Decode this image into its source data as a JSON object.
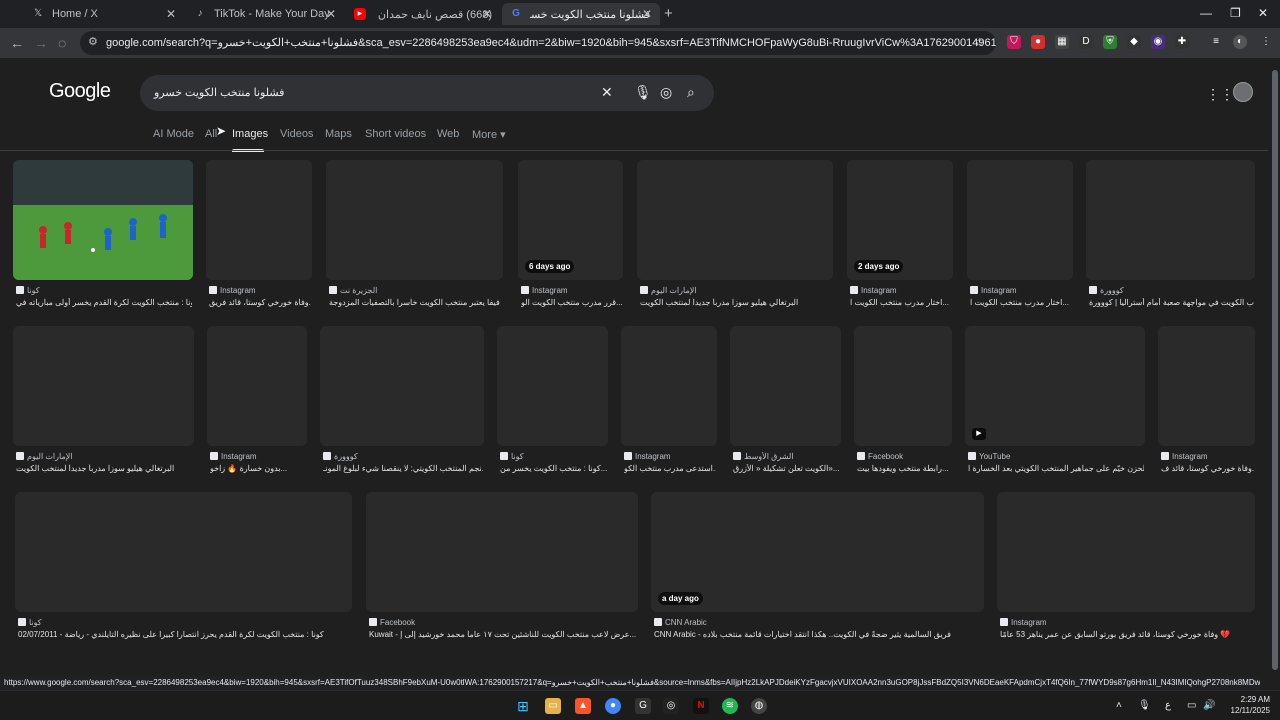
{
  "browser": {
    "tabs": [
      {
        "label": "Home / X",
        "icon": "x-logo-icon",
        "glyph": "𝕏"
      },
      {
        "label": "TikTok - Make Your Day",
        "icon": "tiktok-icon",
        "glyph": "♪"
      },
      {
        "label": "(668) قصص نايف حمدان للنوم ف",
        "icon": "youtube-icon",
        "glyph": "▶"
      },
      {
        "label": "فشلونا منتخب الكويت خسرو - ch",
        "icon": "google-icon",
        "glyph": "G"
      }
    ],
    "new_tab": "+",
    "url": "google.com/search?q=فشلونا+منتخب+الكويت+خسرو&sca_esv=2286498253ea9ec4&udm=2&biw=1920&bih=945&sxsrf=AE3TifNMCHOFpaWyG8uBi-RruugIvrViCw%3A1762900149617&ei=tbgTafS4Jauri-gP28..."
  },
  "google": {
    "logo": "Google",
    "query": "فشلونا منتخب الكويت خسرو",
    "nav": [
      {
        "label": "AI Mode"
      },
      {
        "label": "All"
      },
      {
        "label": "Images"
      },
      {
        "label": "Videos"
      },
      {
        "label": "Maps"
      },
      {
        "label": "Short videos"
      },
      {
        "label": "Web"
      },
      {
        "label": "More ▾"
      }
    ]
  },
  "results": [
    {
      "source": "كونا",
      "title": "كونا : منتخب الكويت لكرة القدم يخسر أولى مبارياته في...",
      "badge": "",
      "photo": true
    },
    {
      "source": "Instagram",
      "title": "وفاة خورخي كوستا، قائد فريق...",
      "badge": ""
    },
    {
      "source": "الجزيرة نت",
      "title": "فيفا يعتبر منتخب الكويت خاسرا بالتصفيات المزدوجة | ...",
      "badge": ""
    },
    {
      "source": "Instagram",
      "title": "قرر مدرب منتخب الكويت الو...",
      "badge": "6 days ago"
    },
    {
      "source": "الإمارات اليوم",
      "title": "البرتغالي هيليو سوزا مدرباً جديداً لمنتخب الكويت",
      "badge": ""
    },
    {
      "source": "Instagram",
      "title": "اختار مدرب منتخب الكويت ا...",
      "badge": "2 days ago"
    },
    {
      "source": "Instagram",
      "title": "اختار مدرب منتخب الكويت ا...",
      "badge": ""
    },
    {
      "source": "كووورة",
      "title": "شباب الكويت في مواجهة صعبة أمام أستراليا | كووورة",
      "badge": ""
    },
    {
      "source": "الإمارات اليوم",
      "title": "البرتغالي هيليو سوزا مدرباً جديداً لمنتخب الكويت",
      "badge": ""
    },
    {
      "source": "Instagram",
      "title": "بدون خسارة 🔥 زاخو...",
      "badge": ""
    },
    {
      "source": "كووورة",
      "title": "نجم المنتخب الكويتي: لا ينقصنا شيء لبلوغ المونـ...",
      "badge": ""
    },
    {
      "source": "كونا",
      "title": "كونا : منتخب الكويت يخسر من...",
      "badge": ""
    },
    {
      "source": "Instagram",
      "title": "استدعى مدرب منتخب الكو...",
      "badge": ""
    },
    {
      "source": "الشرق الأوسط",
      "title": "الكويت تعلن تشكيلة « الأزرق»...",
      "badge": ""
    },
    {
      "source": "Facebook",
      "title": "رابطة منتخب ويفودها بيت...",
      "badge": ""
    },
    {
      "source": "YouTube",
      "title": "الحزن خيّم على جماهير المنتخب الكويتي بعد الخسارة ا...",
      "badge": "",
      "video": true
    },
    {
      "source": "Instagram",
      "title": "وفاة خورخي كوستا، قائد ف...",
      "badge": ""
    },
    {
      "source": "كونا",
      "title": "02/07/2011 - كونا : منتخب الكويت لكرة القدم يحرز انتصارا كبيرا على نظيره التايلندي - رياضة",
      "badge": ""
    },
    {
      "source": "Facebook",
      "title": "Kuwait - عرض لاعب منتخب الكويت للناشئين تحت ١٧ عاماً محمد خورشيد إلى إ...",
      "badge": ""
    },
    {
      "source": "CNN Arabic",
      "title": "CNN Arabic - فريق السالمية يثير ضجةً في الكويت.. هكذا انتقد اختيارات قائمة منتخب بلاده",
      "badge": "a day ago"
    },
    {
      "source": "Instagram",
      "title": "وفاة خورخي كوستا، قائد فريق بورتو السابق عن عمر يناهز 53 عامًا 💔",
      "badge": ""
    }
  ],
  "status_url": "https://www.google.com/search?sca_esv=2286498253ea9ec4&biw=1920&bih=945&sxsrf=AE3TifOfTuuz348SBhF9ebXuM-U0w0tlWA:1762900157217&q=فشلونا+منتخب+الكويت+خسرو&source=lnms&fbs=AIIjpHz2LkAPJDdeiKYzFgacvjxVUIXOAA2nn3uGOP8jJssFBdZQ5I3VN6DEaeKFApdmCjxT4fQ6In_77fWYD9s87g6Hm1Il_N43IMIQohgP2708nk8MDw5Svp...",
  "clock": {
    "time": "2:29 AM",
    "date": "12/11/2025"
  },
  "tray": {
    "lang": "ع"
  }
}
